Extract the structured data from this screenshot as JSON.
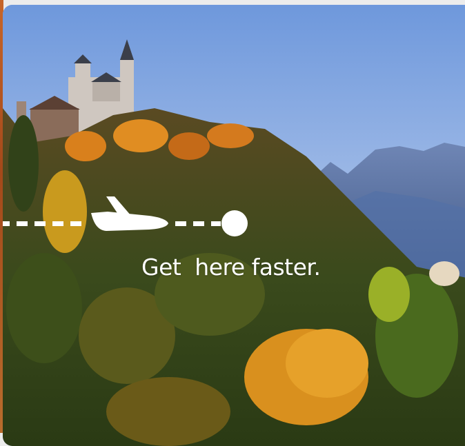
{
  "banner": {
    "tagline": "Get  here faster.",
    "accent_color": "#ffffff"
  },
  "icons": {
    "plane": "airplane-icon",
    "destination": "destination-dot-icon"
  }
}
